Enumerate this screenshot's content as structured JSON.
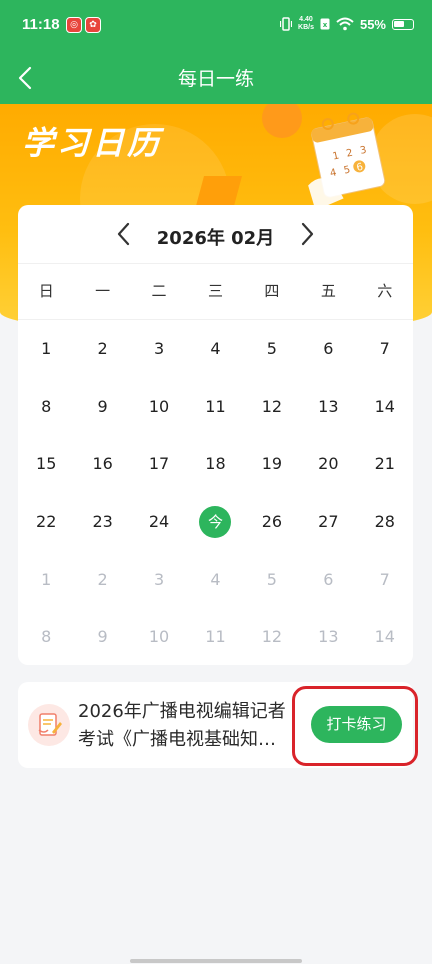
{
  "status_bar": {
    "time": "11:18",
    "app_badges": [
      "",
      ""
    ],
    "net_speed": "4.40",
    "net_unit": "KB/s",
    "battery": "55%"
  },
  "nav": {
    "title": "每日一练",
    "back_icon": "chevron-left-icon"
  },
  "banner": {
    "title": "学习日历",
    "calendar_digits": [
      "1",
      "2",
      "3",
      "4",
      "5",
      "6"
    ]
  },
  "calendar": {
    "month_label": "2026年  02月",
    "prev_icon": "chevron-left-icon",
    "next_icon": "chevron-right-icon",
    "weekdays": [
      "日",
      "一",
      "二",
      "三",
      "四",
      "五",
      "六"
    ],
    "weeks": [
      [
        {
          "label": "1"
        },
        {
          "label": "2"
        },
        {
          "label": "3"
        },
        {
          "label": "4"
        },
        {
          "label": "5"
        },
        {
          "label": "6"
        },
        {
          "label": "7"
        }
      ],
      [
        {
          "label": "8"
        },
        {
          "label": "9"
        },
        {
          "label": "10"
        },
        {
          "label": "11"
        },
        {
          "label": "12"
        },
        {
          "label": "13"
        },
        {
          "label": "14"
        }
      ],
      [
        {
          "label": "15"
        },
        {
          "label": "16"
        },
        {
          "label": "17"
        },
        {
          "label": "18"
        },
        {
          "label": "19"
        },
        {
          "label": "20"
        },
        {
          "label": "21"
        }
      ],
      [
        {
          "label": "22"
        },
        {
          "label": "23"
        },
        {
          "label": "24"
        },
        {
          "label": "今",
          "today": true
        },
        {
          "label": "26"
        },
        {
          "label": "27"
        },
        {
          "label": "28"
        }
      ],
      [
        {
          "label": "1",
          "muted": true
        },
        {
          "label": "2",
          "muted": true
        },
        {
          "label": "3",
          "muted": true
        },
        {
          "label": "4",
          "muted": true
        },
        {
          "label": "5",
          "muted": true
        },
        {
          "label": "6",
          "muted": true
        },
        {
          "label": "7",
          "muted": true
        }
      ],
      [
        {
          "label": "8",
          "muted": true
        },
        {
          "label": "9",
          "muted": true
        },
        {
          "label": "10",
          "muted": true
        },
        {
          "label": "11",
          "muted": true
        },
        {
          "label": "12",
          "muted": true
        },
        {
          "label": "13",
          "muted": true
        },
        {
          "label": "14",
          "muted": true
        }
      ]
    ]
  },
  "task": {
    "title": "2026年广播电视编辑记者考试《广播电视基础知…",
    "button_label": "打卡练习"
  },
  "colors": {
    "primary_green": "#2db55d",
    "banner_orange": "#ffab00",
    "highlight_red": "#d9232a"
  }
}
